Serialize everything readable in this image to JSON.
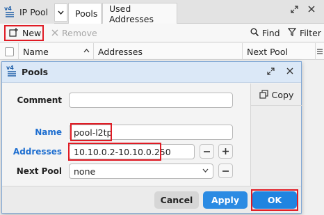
{
  "app": {
    "title": "IP Pool"
  },
  "tabs": [
    {
      "label": "Pools"
    },
    {
      "label": "Used Addresses"
    }
  ],
  "toolbar": {
    "new_label": "New",
    "remove_label": "Remove",
    "find_label": "Find",
    "filter_label": "Filter"
  },
  "table": {
    "columns": [
      "Name",
      "Addresses",
      "Next Pool"
    ]
  },
  "dialog": {
    "title": "Pools",
    "copy_label": "Copy",
    "fields": {
      "comment": {
        "label": "Comment",
        "value": ""
      },
      "name": {
        "label": "Name",
        "value": "pool-l2tp"
      },
      "addresses": {
        "label": "Addresses",
        "value": "10.10.0.2-10.10.0.250"
      },
      "next_pool": {
        "label": "Next Pool",
        "value": "none"
      }
    },
    "buttons": {
      "cancel": "Cancel",
      "apply": "Apply",
      "ok": "OK"
    }
  },
  "colors": {
    "accent_blue": "#1f84e0",
    "highlight_red": "#e01b24",
    "label_blue": "#1f6fd0"
  }
}
